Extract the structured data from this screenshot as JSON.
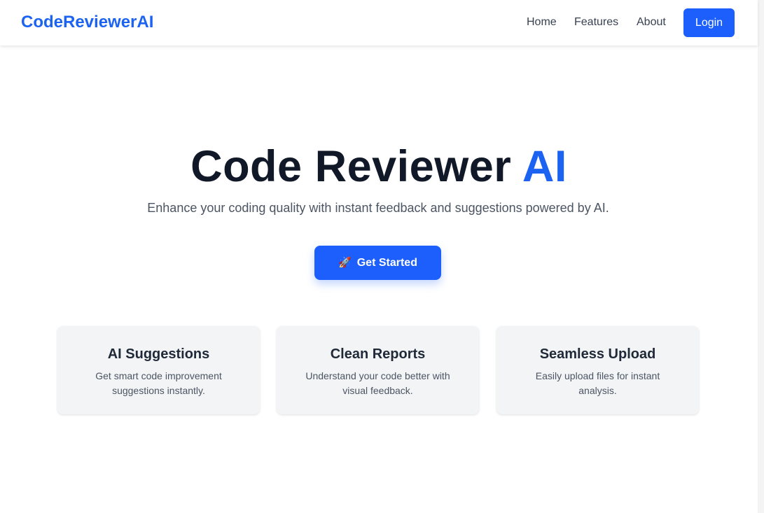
{
  "nav": {
    "brand": "CodeReviewerAI",
    "links": [
      "Home",
      "Features",
      "About"
    ],
    "login_label": "Login"
  },
  "hero": {
    "title_main": "Code Reviewer ",
    "title_accent": "AI",
    "subtitle": "Enhance your coding quality with instant feedback and suggestions powered by AI.",
    "cta_icon": "🚀",
    "cta_label": "Get Started"
  },
  "features": [
    {
      "title": "AI Suggestions",
      "description": "Get smart code improvement suggestions instantly."
    },
    {
      "title": "Clean Reports",
      "description": "Understand your code better with visual feedback."
    },
    {
      "title": "Seamless Upload",
      "description": "Easily upload files for instant analysis."
    }
  ],
  "colors": {
    "accent": "#1d63f2",
    "button": "#1d5ffc",
    "heading": "#111827",
    "card_bg": "#f3f4f6"
  }
}
